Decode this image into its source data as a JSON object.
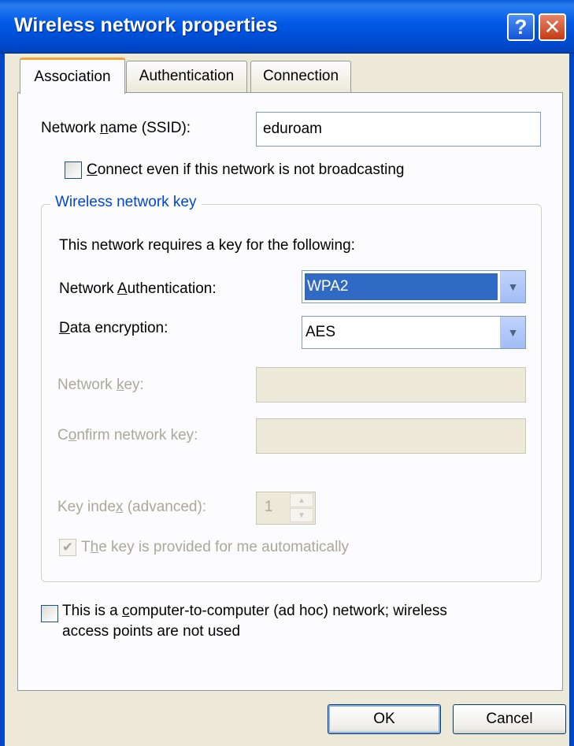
{
  "window": {
    "title": "Wireless network properties",
    "help": "?",
    "close": "✕"
  },
  "tabs": [
    {
      "label": "Association"
    },
    {
      "label": "Authentication"
    },
    {
      "label": "Connection"
    }
  ],
  "ssid": {
    "label_pre": "Network ",
    "label_ul": "n",
    "label_post": "ame (SSID):",
    "value": "eduroam"
  },
  "broadcast": {
    "label_pre": "",
    "label_ul": "C",
    "label_post": "onnect even if this network is not broadcasting",
    "checked": false
  },
  "key_group": {
    "title": "Wireless network key",
    "intro": "This network requires a key for the following:",
    "auth": {
      "label_pre": "Network ",
      "label_ul": "A",
      "label_post": "uthentication:",
      "value": "WPA2"
    },
    "encryption": {
      "label_pre": "",
      "label_ul": "D",
      "label_post": "ata encryption:",
      "value": "AES"
    },
    "network_key": {
      "label_pre": "Network ",
      "label_ul": "k",
      "label_post": "ey:",
      "value": ""
    },
    "confirm_key": {
      "label_pre": "C",
      "label_ul": "o",
      "label_post": "nfirm network key:",
      "value": ""
    },
    "key_index": {
      "label_pre": "Key inde",
      "label_ul": "x",
      "label_post": " (advanced):",
      "value": "1"
    },
    "auto_key": {
      "label_pre": "T",
      "label_ul": "h",
      "label_post": "e key is provided for me automatically",
      "checked": true,
      "mark": "✔"
    }
  },
  "adhoc": {
    "line1_pre": "This is a ",
    "line1_ul": "c",
    "line1_post": "omputer-to-computer (ad hoc) network; wireless",
    "line2": "access points are not used",
    "checked": false
  },
  "buttons": {
    "ok": "OK",
    "cancel": "Cancel"
  },
  "colors": {
    "title_bar": "#0058e6",
    "window_bg": "#ece9d8",
    "panel_bg": "#fcfcfe",
    "selection": "#316ac5",
    "group_title": "#0046d5"
  }
}
